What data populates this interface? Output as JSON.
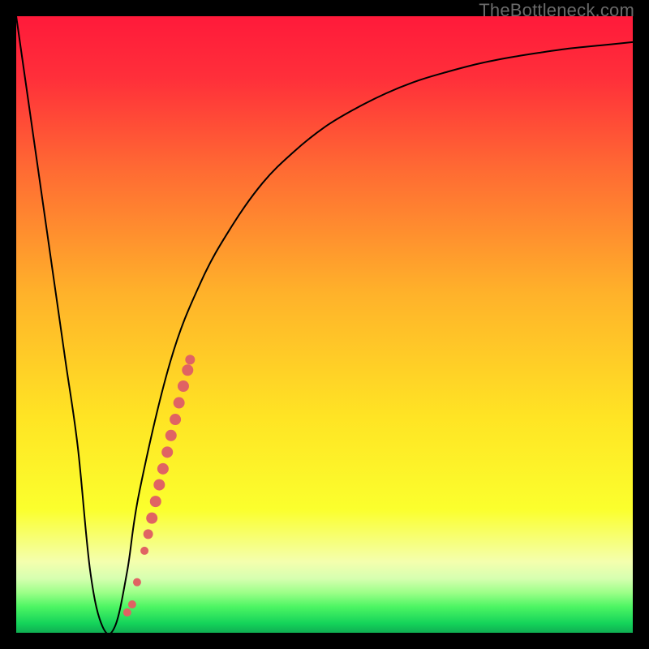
{
  "watermark": "TheBottleneck.com",
  "chart_data": {
    "type": "line",
    "title": "",
    "xlabel": "",
    "ylabel": "",
    "xlim": [
      0,
      100
    ],
    "ylim": [
      0,
      100
    ],
    "series": [
      {
        "name": "bottleneck-curve",
        "x": [
          0,
          2,
          4,
          6,
          8,
          10,
          12,
          14,
          16,
          18,
          20,
          25,
          30,
          35,
          40,
          45,
          50,
          55,
          60,
          65,
          70,
          75,
          80,
          85,
          90,
          95,
          100
        ],
        "y": [
          100,
          86,
          72,
          58,
          44,
          30,
          10,
          1,
          1,
          10,
          23,
          44,
          57,
          66,
          73,
          78,
          82,
          85,
          87.5,
          89.5,
          91,
          92.3,
          93.3,
          94.1,
          94.8,
          95.3,
          95.8
        ]
      }
    ],
    "highlight_points": {
      "name": "highlighted-range",
      "color": "#e06363",
      "points": [
        {
          "x": 18.0,
          "y": 3.3,
          "r": 5
        },
        {
          "x": 18.8,
          "y": 4.6,
          "r": 5
        },
        {
          "x": 19.6,
          "y": 8.2,
          "r": 5
        },
        {
          "x": 20.8,
          "y": 13.3,
          "r": 5
        },
        {
          "x": 21.4,
          "y": 16.0,
          "r": 6
        },
        {
          "x": 22.0,
          "y": 18.6,
          "r": 7
        },
        {
          "x": 22.6,
          "y": 21.3,
          "r": 7
        },
        {
          "x": 23.2,
          "y": 24.0,
          "r": 7
        },
        {
          "x": 23.8,
          "y": 26.6,
          "r": 7
        },
        {
          "x": 24.5,
          "y": 29.3,
          "r": 7
        },
        {
          "x": 25.1,
          "y": 32.0,
          "r": 7
        },
        {
          "x": 25.8,
          "y": 34.6,
          "r": 7
        },
        {
          "x": 26.4,
          "y": 37.3,
          "r": 7
        },
        {
          "x": 27.1,
          "y": 40.0,
          "r": 7
        },
        {
          "x": 27.8,
          "y": 42.6,
          "r": 7
        },
        {
          "x": 28.2,
          "y": 44.3,
          "r": 6
        }
      ]
    },
    "gradient_stops": [
      {
        "offset": 0.0,
        "color": "#ff1a3a"
      },
      {
        "offset": 0.1,
        "color": "#ff2f3a"
      },
      {
        "offset": 0.25,
        "color": "#ff6b33"
      },
      {
        "offset": 0.45,
        "color": "#ffb22a"
      },
      {
        "offset": 0.65,
        "color": "#ffe424"
      },
      {
        "offset": 0.8,
        "color": "#fbff2d"
      },
      {
        "offset": 0.885,
        "color": "#f4ffae"
      },
      {
        "offset": 0.912,
        "color": "#d6ffb0"
      },
      {
        "offset": 0.935,
        "color": "#9cff88"
      },
      {
        "offset": 0.958,
        "color": "#4cf563"
      },
      {
        "offset": 0.985,
        "color": "#14d35a"
      },
      {
        "offset": 1.0,
        "color": "#0fae52"
      }
    ]
  }
}
